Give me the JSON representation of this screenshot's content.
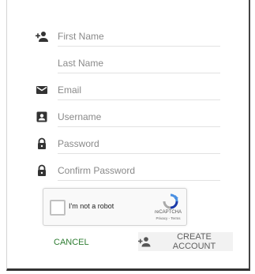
{
  "form": {
    "first_name": {
      "placeholder": "First Name",
      "icon": "add-person-icon"
    },
    "last_name": {
      "placeholder": "Last Name"
    },
    "email": {
      "placeholder": "Email",
      "icon": "envelope-icon"
    },
    "username": {
      "placeholder": "Username",
      "icon": "account-box-icon"
    },
    "password": {
      "placeholder": "Password",
      "icon": "lock-icon"
    },
    "confirm_password": {
      "placeholder": "Confirm Password",
      "icon": "lock-icon"
    }
  },
  "captcha": {
    "label": "I'm not a robot",
    "brand": "reCAPTCHA",
    "terms": "Privacy - Terms",
    "checked": false
  },
  "actions": {
    "cancel_label": "CANCEL",
    "create_label": "CREATE ACCOUNT",
    "create_icon": "add-person-icon"
  },
  "colors": {
    "accent_green": "#2e7d32",
    "icon": "#333333",
    "text_muted": "#8a8a8a",
    "button_bg": "#f2f2f2"
  }
}
